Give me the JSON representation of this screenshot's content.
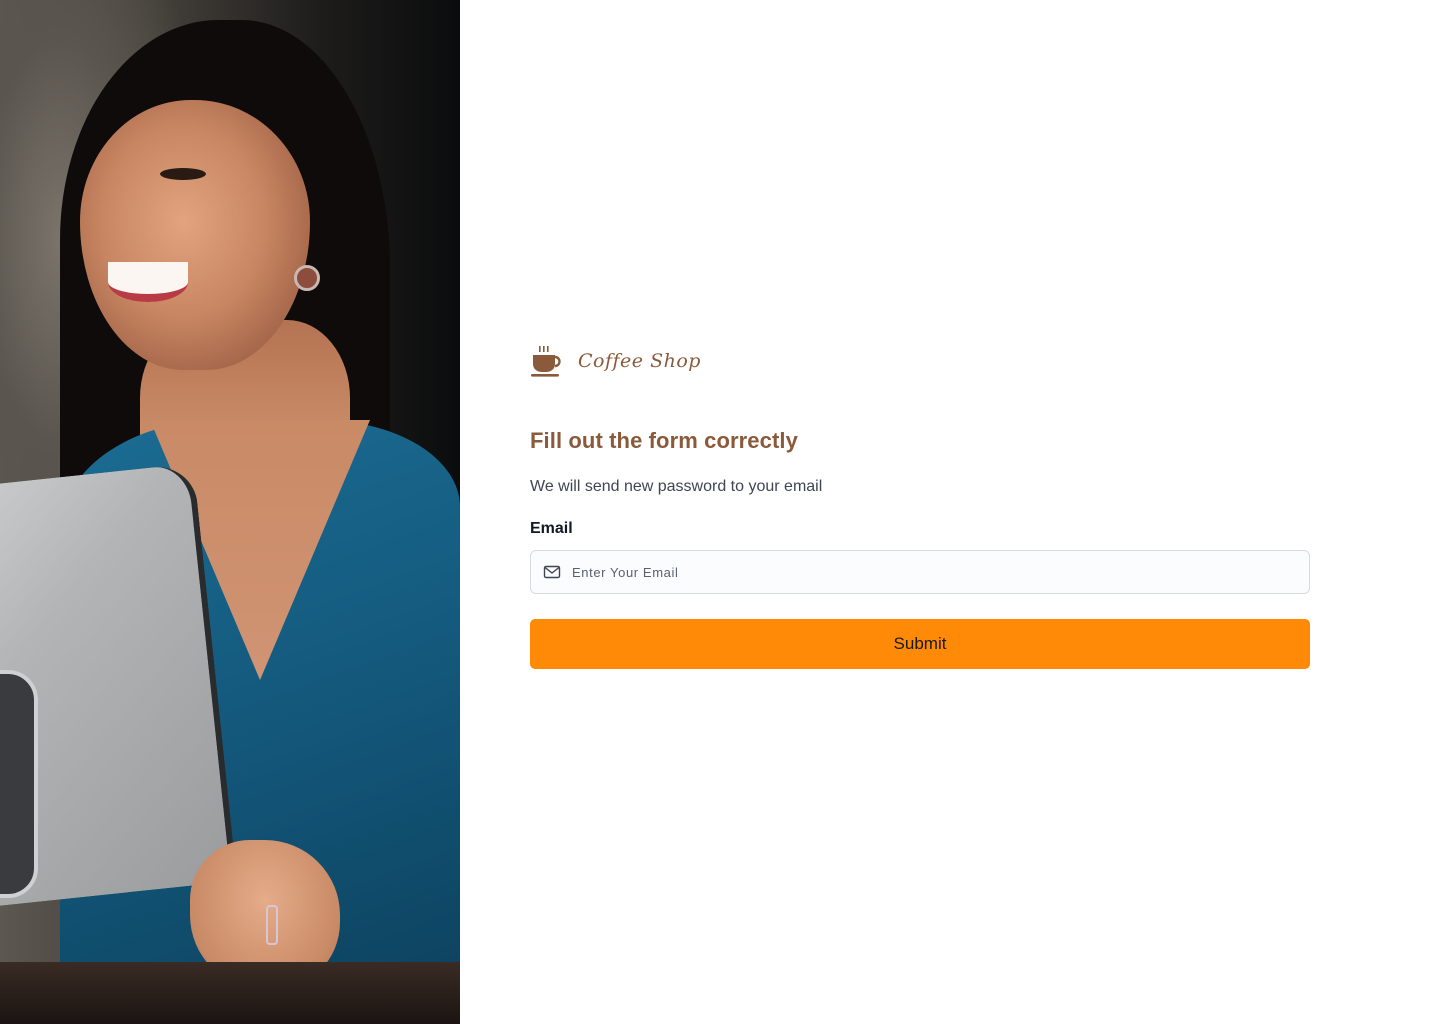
{
  "brand": {
    "name": "Coffee Shop",
    "icon": "coffee-cup-icon",
    "color": "#8a5a3b"
  },
  "hero_image": {
    "description_icon": "photo"
  },
  "form": {
    "title": "Fill out the form correctly",
    "subtitle": "We will send new password to your email",
    "email": {
      "label": "Email",
      "placeholder": "Enter Your Email",
      "value": "",
      "icon": "mail-icon"
    },
    "submit_label": "Submit",
    "accent_color": "#ff8a08"
  }
}
